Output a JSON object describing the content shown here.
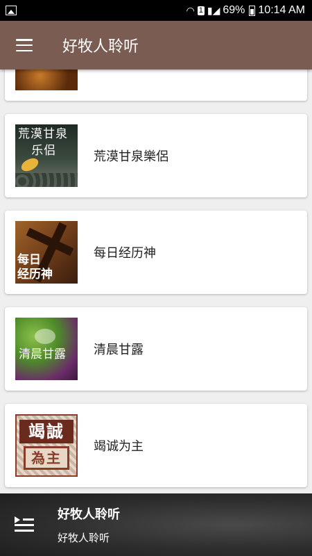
{
  "status_bar": {
    "image_icon": "image-icon",
    "wifi_icon": "wifi-icon",
    "sim_badge": "1",
    "signal_icon": "signal-icon",
    "battery_percent": "69%",
    "battery_icon": "battery-icon",
    "time": "10:14 AM"
  },
  "app_bar": {
    "menu_icon": "menu-icon",
    "title": "好牧人聆听"
  },
  "list": {
    "items": [
      {
        "label": "荒漠甘泉樂侶",
        "thumb_text": "荒漠甘泉\n乐侣"
      },
      {
        "label": "每日经历神",
        "thumb_text": "每日\n经历神"
      },
      {
        "label": "清晨甘露",
        "thumb_text": "清晨甘露"
      },
      {
        "label": "竭诚为主",
        "thumb_text_top": "竭誠",
        "thumb_text_bottom": "為主"
      }
    ]
  },
  "player": {
    "queue_icon": "queue-music-icon",
    "title": "好牧人聆听",
    "subtitle": "好牧人聆听"
  },
  "colors": {
    "app_bar": "#7a5c52",
    "background": "#efefef",
    "player": "#2e2e2e"
  }
}
